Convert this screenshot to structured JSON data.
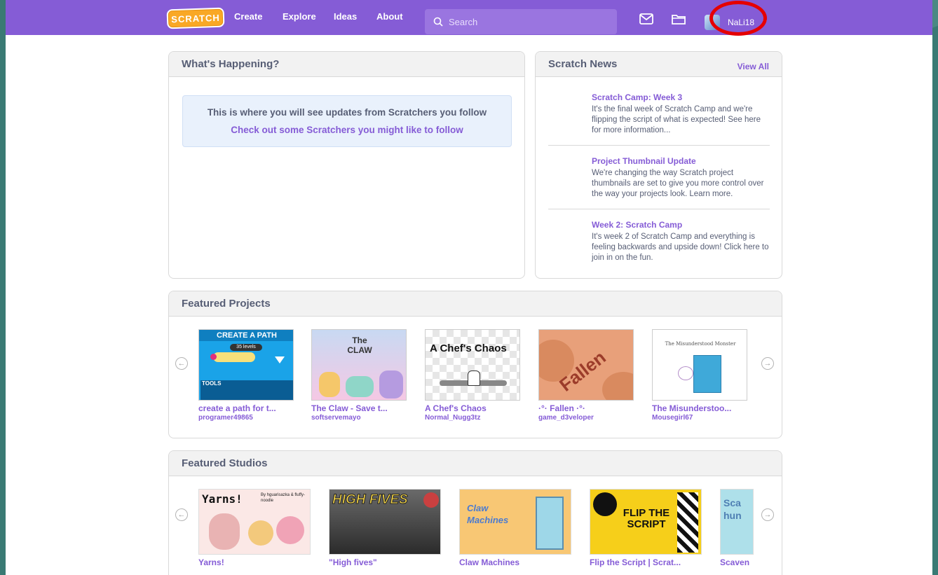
{
  "nav": {
    "logo": "SCRATCH",
    "links": [
      "Create",
      "Explore",
      "Ideas",
      "About"
    ],
    "search_placeholder": "Search",
    "username": "NaLi18"
  },
  "happening": {
    "title": "What's Happening?",
    "notice_text": "This is where you will see updates from Scratchers you follow",
    "notice_link": "Check out some Scratchers you might like to follow"
  },
  "news": {
    "title": "Scratch News",
    "view_all": "View All",
    "items": [
      {
        "title": "Scratch Camp: Week 3",
        "body": "It's the final week of Scratch Camp and we're flipping the script of what is expected! See here for more information..."
      },
      {
        "title": "Project Thumbnail Update",
        "body": "We're changing the way Scratch project thumbnails are set to give you more control over the way your projects look. Learn more."
      },
      {
        "title": "Week 2: Scratch Camp",
        "body": "It's week 2 of Scratch Camp and everything is feeling backwards and upside down! Click here to join in on the fun."
      }
    ]
  },
  "featured_projects": {
    "title": "Featured Projects",
    "items": [
      {
        "title": "create a path for t...",
        "author": "programer49865",
        "thumb_text": "CREATE A PATH",
        "thumb_sub": "35 levels",
        "thumb_tools": "TOOLS"
      },
      {
        "title": "The Claw - Save t...",
        "author": "softservemayo",
        "thumb_text": "The CLAW"
      },
      {
        "title": "A Chef's Chaos",
        "author": "Normal_Nugg3tz",
        "thumb_text": "A Chef's Chaos"
      },
      {
        "title": "·°· Fallen ·°·",
        "author": "game_d3veloper",
        "thumb_text": "Fallen"
      },
      {
        "title": "The Misunderstoo...",
        "author": "Mousegirl67",
        "thumb_text": "The Misunderstood Monster"
      }
    ]
  },
  "featured_studios": {
    "title": "Featured Studios",
    "items": [
      {
        "title": "Yarns!",
        "thumb_text": "Yarns!",
        "thumb_sub": "By hguarisazka & fluffy-noodle"
      },
      {
        "title": "\"High fives\"",
        "thumb_text": "HIGH FIVES"
      },
      {
        "title": "Claw Machines",
        "thumb_text": "Claw Machines"
      },
      {
        "title": "Flip the Script | Scrat...",
        "thumb_text": "FLIP THE SCRIPT"
      },
      {
        "title": "Scaven",
        "thumb_text": "Sca hun"
      }
    ]
  },
  "colors": {
    "nav": "#855cd6",
    "accent": "#855cd6",
    "text": "#575e75",
    "annotation": "#e50000"
  }
}
